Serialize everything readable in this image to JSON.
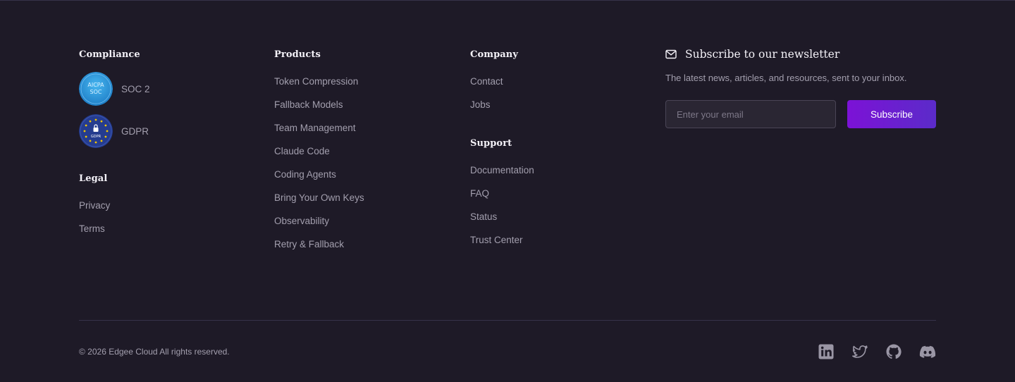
{
  "compliance": {
    "heading": "Compliance",
    "badges": [
      {
        "label": "SOC 2",
        "icon": "soc2-badge-icon",
        "badge_line1": "AICPA",
        "badge_line2": "SOC"
      },
      {
        "label": "GDPR",
        "icon": "gdpr-badge-icon",
        "badge_text": "GDPR"
      }
    ]
  },
  "legal": {
    "heading": "Legal",
    "links": [
      "Privacy",
      "Terms"
    ]
  },
  "products": {
    "heading": "Products",
    "links": [
      "Token Compression",
      "Fallback Models",
      "Team Management",
      "Claude Code",
      "Coding Agents",
      "Bring Your Own Keys",
      "Observability",
      "Retry & Fallback"
    ]
  },
  "company": {
    "heading": "Company",
    "links": [
      "Contact",
      "Jobs"
    ]
  },
  "support": {
    "heading": "Support",
    "links": [
      "Documentation",
      "FAQ",
      "Status",
      "Trust Center"
    ]
  },
  "newsletter": {
    "icon": "mail-icon",
    "title": "Subscribe to our newsletter",
    "description": "The latest news, articles, and resources, sent to your inbox.",
    "email_placeholder": "Enter your email",
    "email_value": "",
    "button_label": "Subscribe"
  },
  "bottom": {
    "copyright": "© 2026 Edgee Cloud All rights reserved.",
    "social": [
      "linkedin-icon",
      "twitter-icon",
      "github-icon",
      "discord-icon"
    ]
  },
  "colors": {
    "background": "#1e1a27",
    "heading": "#f4f2f8",
    "text": "#a39fae",
    "button_gradient_start": "#7c12d6",
    "button_gradient_end": "#5b2bc9"
  }
}
